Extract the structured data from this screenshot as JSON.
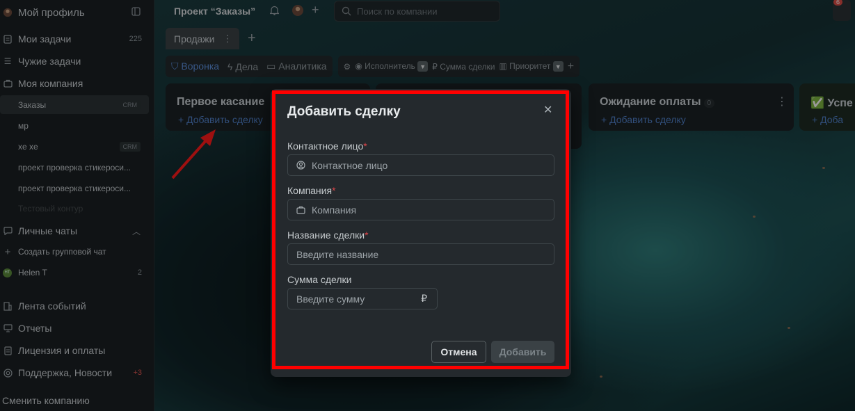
{
  "sidebar": {
    "profile": "Мой профиль",
    "my_tasks": {
      "label": "Мои задачи",
      "count": "225"
    },
    "others_tasks": "Чужие задачи",
    "my_company": "Моя компания",
    "projects": [
      {
        "label": "Заказы",
        "badge": "CRM"
      },
      {
        "label": "мр",
        "badge": ""
      },
      {
        "label": "xe xe",
        "badge": "CRM"
      },
      {
        "label": "проект проверка стикероси...",
        "badge": ""
      },
      {
        "label": "проект проверка стикероси...",
        "badge": ""
      },
      {
        "label": "Тестовый контур",
        "badge": ""
      }
    ],
    "personal_chats": "Личные чаты",
    "create_group_chat": "Создать групповой чат",
    "chat_user": {
      "initials": "HT",
      "name": "Helen T",
      "count": "2"
    },
    "event_feed": "Лента событий",
    "reports": "Отчеты",
    "license": "Лицензия и оплаты",
    "support": {
      "label": "Поддержка, Новости",
      "count": "+3"
    },
    "switch_company": "Сменить компанию"
  },
  "topbar": {
    "project_title": "Проект “Заказы”",
    "search_placeholder": "Поиск по компании",
    "notif_count": "6"
  },
  "tabs": {
    "active": "Продажи"
  },
  "views": {
    "funnel": "Воронка",
    "deals": "Дела",
    "analytics": "Аналитика",
    "filters": [
      "Исполнитель",
      "Сумма сделки",
      "Приоритет"
    ]
  },
  "columns": [
    {
      "title": "Первое касание",
      "add": "+ Добавить сделку",
      "count": ""
    },
    {
      "title": "Ожидание оплаты",
      "add": "+ Добавить сделку",
      "count": "0"
    },
    {
      "title": "✅ Успе",
      "add": "+ Доба",
      "count": ""
    }
  ],
  "modal": {
    "title": "Добавить сделку",
    "contact_label": "Контактное лицо",
    "contact_placeholder": "Контактное лицо",
    "company_label": "Компания",
    "company_placeholder": "Компания",
    "deal_name_label": "Название сделки",
    "deal_name_placeholder": "Введите название",
    "amount_label": "Сумма сделки",
    "amount_placeholder": "Введите сумму",
    "currency": "₽",
    "cancel": "Отмена",
    "add": "Добавить"
  }
}
